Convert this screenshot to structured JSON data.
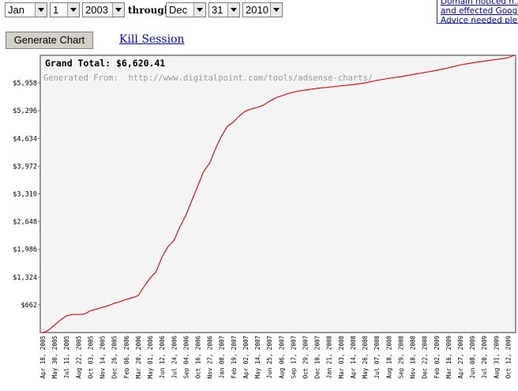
{
  "controls": {
    "start_month": "Jan",
    "start_day": "1",
    "start_year": "2003",
    "through_label": "through",
    "end_month": "Dec",
    "end_day": "31",
    "end_year": "2010"
  },
  "advice_box": {
    "lines": [
      "Domain noticed h...",
      "and effected Google",
      "Advice needed plea"
    ]
  },
  "actions": {
    "generate_label": "Generate Chart",
    "kill_label": "Kill Session"
  },
  "colors": {
    "line": "#dd1111",
    "plot_bg": "#f4f4f4",
    "frame": "#777777"
  },
  "chart_data": {
    "type": "line",
    "title": "Grand Total: $6,620.41",
    "subtitle": "Generated From:  http://www.digitalpoint.com/tools/adsense-charts/",
    "xlabel": "",
    "ylabel": "",
    "y_ticks": [
      "$662",
      "$1,324",
      "$1,986",
      "$2,648",
      "$3,310",
      "$3,972",
      "$4,634",
      "$5,296",
      "$5,958"
    ],
    "y_tick_values": [
      662,
      1324,
      1986,
      2648,
      3310,
      3972,
      4634,
      5296,
      5958
    ],
    "ylim": [
      0,
      6620.41
    ],
    "grid": false,
    "x_ticks": [
      "Apr 18, 2005",
      "May 30, 2005",
      "Jul 11, 2005",
      "Aug 22, 2005",
      "Oct 03, 2005",
      "Nov 14, 2005",
      "Dec 26, 2005",
      "Feb 06, 2006",
      "Mar 20, 2006",
      "May 01, 2006",
      "Jun 12, 2006",
      "Jul 24, 2006",
      "Sep 04, 2006",
      "Oct 16, 2006",
      "Nov 27, 2006",
      "Jan 08, 2007",
      "Feb 19, 2007",
      "Apr 02, 2007",
      "May 14, 2007",
      "Jun 25, 2007",
      "Aug 06, 2007",
      "Sep 17, 2007",
      "Oct 29, 2007",
      "Dec 10, 2007",
      "Jan 21, 2008",
      "Mar 03, 2008",
      "Apr 14, 2008",
      "May 26, 2008",
      "Jul 07, 2008",
      "Aug 18, 2008",
      "Sep 29, 2008",
      "Nov 10, 2008",
      "Dec 22, 2008",
      "Feb 02, 2009",
      "Mar 16, 2009",
      "Apr 27, 2009",
      "Jun 08, 2009",
      "Jul 20, 2009",
      "Aug 31, 2009",
      "Oct 12, 2009"
    ],
    "series": [
      {
        "x": [
          "2005-04-18",
          "2005-04-28",
          "2005-05-09",
          "2005-05-30",
          "2005-06-20",
          "2005-07-11",
          "2005-08-01",
          "2005-08-22",
          "2005-09-12",
          "2005-10-03",
          "2005-10-24",
          "2005-11-14",
          "2005-12-05",
          "2005-12-26",
          "2006-01-16",
          "2006-02-06",
          "2006-02-27",
          "2006-03-20",
          "2006-04-10",
          "2006-05-01",
          "2006-05-22",
          "2006-06-12",
          "2006-07-03",
          "2006-07-24",
          "2006-08-14",
          "2006-09-04",
          "2006-09-25",
          "2006-10-16",
          "2006-11-06",
          "2006-11-27",
          "2006-12-18",
          "2007-01-08",
          "2007-01-29",
          "2007-02-19",
          "2007-03-12",
          "2007-04-02",
          "2007-04-23",
          "2007-05-14",
          "2007-06-04",
          "2007-06-25",
          "2007-07-16",
          "2007-08-06",
          "2007-08-27",
          "2007-09-17",
          "2007-10-08",
          "2007-10-29",
          "2007-11-19",
          "2007-12-10",
          "2008-01-21",
          "2008-03-03",
          "2008-04-14",
          "2008-05-26",
          "2008-07-07",
          "2008-08-18",
          "2008-09-29",
          "2008-11-10",
          "2008-12-22",
          "2009-02-02",
          "2009-03-16",
          "2009-04-27",
          "2009-06-08",
          "2009-07-20",
          "2009-08-31",
          "2009-10-12",
          "2009-11-02"
        ],
        "y": [
          0,
          20,
          60,
          180,
          300,
          400,
          430,
          430,
          440,
          520,
          560,
          600,
          640,
          700,
          740,
          790,
          830,
          880,
          1100,
          1300,
          1450,
          1800,
          2050,
          2200,
          2520,
          2800,
          3150,
          3500,
          3850,
          4050,
          4400,
          4700,
          4930,
          5030,
          5180,
          5290,
          5340,
          5380,
          5430,
          5520,
          5600,
          5650,
          5700,
          5740,
          5770,
          5790,
          5810,
          5830,
          5860,
          5890,
          5920,
          5960,
          6020,
          6070,
          6110,
          6160,
          6210,
          6260,
          6320,
          6390,
          6440,
          6480,
          6520,
          6560,
          6620
        ]
      }
    ]
  }
}
